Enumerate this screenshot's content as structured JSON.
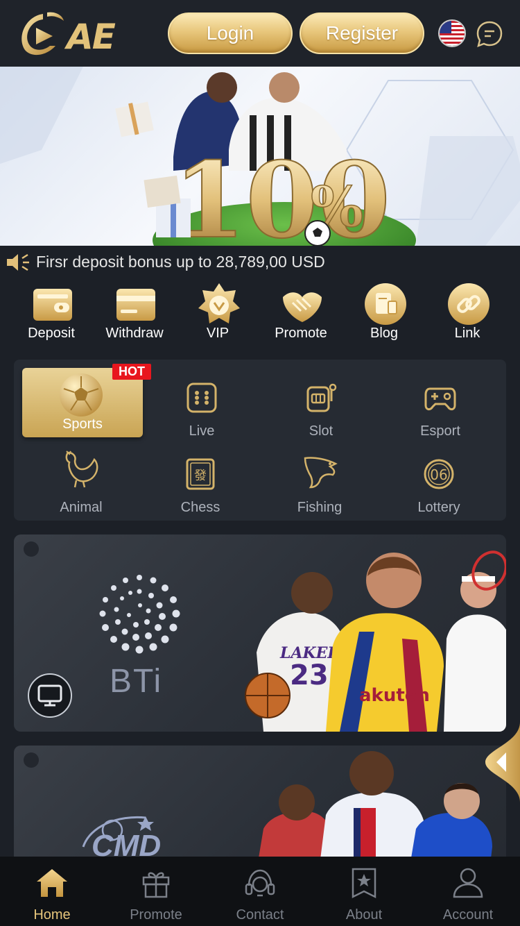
{
  "header": {
    "logo_text": "AE",
    "login_label": "Login",
    "register_label": "Register",
    "flag_icon": "us-flag-icon",
    "chat_icon": "chat-icon"
  },
  "banner": {
    "headline": "100",
    "percent": "%"
  },
  "marquee": {
    "icon": "speaker-icon",
    "text": "Firsr deposit bonus up to 28,789,00 USD"
  },
  "quick_actions": [
    {
      "label": "Deposit",
      "icon": "wallet-icon"
    },
    {
      "label": "Withdraw",
      "icon": "card-icon"
    },
    {
      "label": "VIP",
      "icon": "vip-badge-icon"
    },
    {
      "label": "Promote",
      "icon": "handshake-icon"
    },
    {
      "label": "Blog",
      "icon": "blog-icon"
    },
    {
      "label": "Link",
      "icon": "link-icon"
    }
  ],
  "games": {
    "hot_badge": "HOT",
    "items": [
      {
        "label": "Sports",
        "icon": "soccer-ball-icon",
        "active": true
      },
      {
        "label": "Live",
        "icon": "dice-icon"
      },
      {
        "label": "Slot",
        "icon": "slot-machine-icon"
      },
      {
        "label": "Esport",
        "icon": "gamepad-icon"
      },
      {
        "label": "Animal",
        "icon": "rooster-icon"
      },
      {
        "label": "Chess",
        "icon": "mahjong-tile-icon"
      },
      {
        "label": "Fishing",
        "icon": "fish-icon"
      },
      {
        "label": "Lottery",
        "icon": "lottery-ball-icon"
      }
    ]
  },
  "providers": [
    {
      "name": "BTi"
    },
    {
      "name": "CMD"
    }
  ],
  "bottom_nav": [
    {
      "label": "Home",
      "icon": "home-icon",
      "active": true
    },
    {
      "label": "Promote",
      "icon": "gift-icon"
    },
    {
      "label": "Contact",
      "icon": "headset-icon"
    },
    {
      "label": "About",
      "icon": "about-star-icon"
    },
    {
      "label": "Account",
      "icon": "user-icon"
    }
  ],
  "colors": {
    "background": "#1c2027",
    "gold": "#e7c67c",
    "hot_red": "#e8161e",
    "nav_inactive": "#7b8089"
  }
}
